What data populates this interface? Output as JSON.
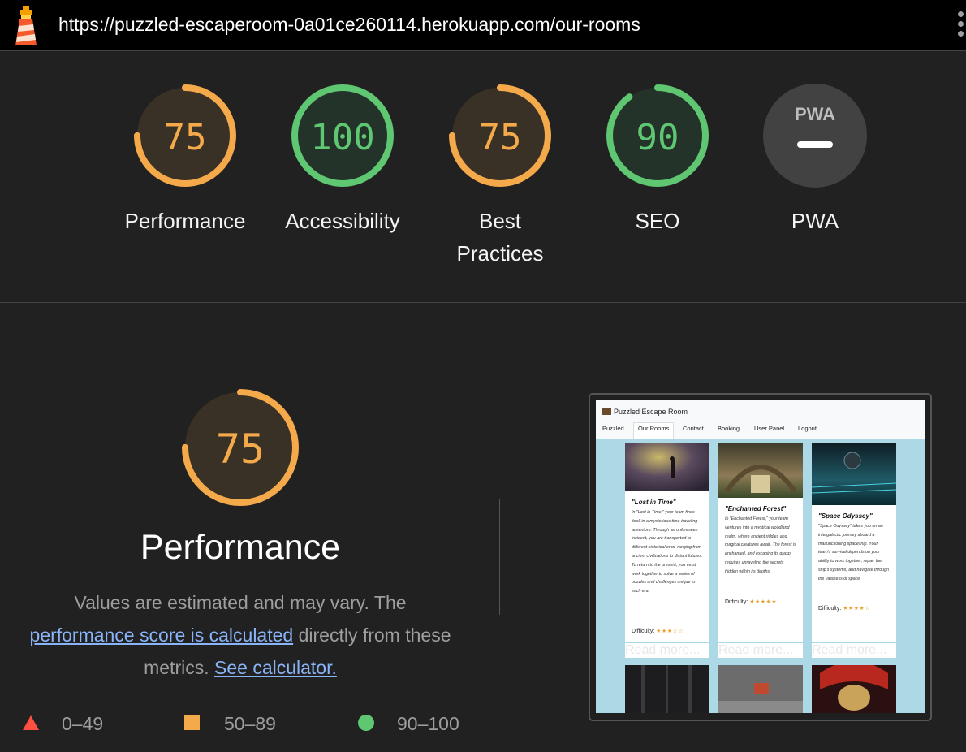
{
  "browser": {
    "url": "https://puzzled-escaperoom-0a01ce260114.herokuapp.com/our-rooms"
  },
  "colors": {
    "average": "#ffa400",
    "pass": "#0cce6b",
    "fail": "#ff4e42",
    "link": "#8ab4f8"
  },
  "gauges": [
    {
      "score": "75",
      "label": "Performance",
      "value": 0.75,
      "color": "#f4a94b"
    },
    {
      "score": "100",
      "label": "Accessibility",
      "value": 1.0,
      "color": "#5fc671"
    },
    {
      "score": "75",
      "label_line1": "Best",
      "label_line2": "Practices",
      "value": 0.75,
      "color": "#f4a94b"
    },
    {
      "score": "90",
      "label": "SEO",
      "value": 0.9,
      "color": "#5fc671"
    },
    {
      "badge": "PWA",
      "label": "PWA"
    }
  ],
  "performance": {
    "score": "75",
    "value": 0.75,
    "title": "Performance",
    "desc_1": "Values are estimated and may vary. The",
    "link_1": "performance score is calculated",
    "desc_2": " directly from these",
    "desc_3": "metrics. ",
    "link_2": "See calculator."
  },
  "legend": [
    {
      "shape": "triangle",
      "range": "0–49"
    },
    {
      "shape": "square",
      "range": "50–89"
    },
    {
      "shape": "circle",
      "range": "90–100"
    }
  ],
  "thumbnail": {
    "brand": "Puzzled Escape Room",
    "nav": [
      "Puzzled",
      "Our Rooms",
      "Contact",
      "Booking",
      "User Panel",
      "Logout"
    ],
    "active_nav": "Our Rooms",
    "cards": [
      {
        "title": "\"Lost in Time\"",
        "body": "In \"Lost in Time,\" your team finds itself in a mysterious time-traveling adventure. Through an unforeseen incident, you are transported to different historical eras, ranging from ancient civilizations to distant futures. To return to the present, you must work together to solve a series of puzzles and challenges unique to each era.",
        "difficulty": "Difficulty:",
        "stars": "★★★☆☆",
        "rating": 3,
        "button": "Read more..."
      },
      {
        "title": "\"Enchanted Forest\"",
        "body": "In \"Enchanted Forest,\" your team ventures into a mystical woodland realm, where ancient riddles and magical creatures await. The forest is enchanted, and escaping its grasp requires unraveling the secrets hidden within its depths.",
        "difficulty": "Difficulty:",
        "stars": "★★★★★",
        "rating": 5,
        "button": "Read more..."
      },
      {
        "title": "\"Space Odyssey\"",
        "body": "\"Space Odyssey\" takes you on an intergalactic journey aboard a malfunctioning spaceship. Your team's survival depends on your ability to work together, repair the ship's systems, and navigate through the vastness of space.",
        "difficulty": "Difficulty:",
        "stars": "★★★★☆",
        "rating": 4,
        "button": "Read more..."
      }
    ]
  }
}
